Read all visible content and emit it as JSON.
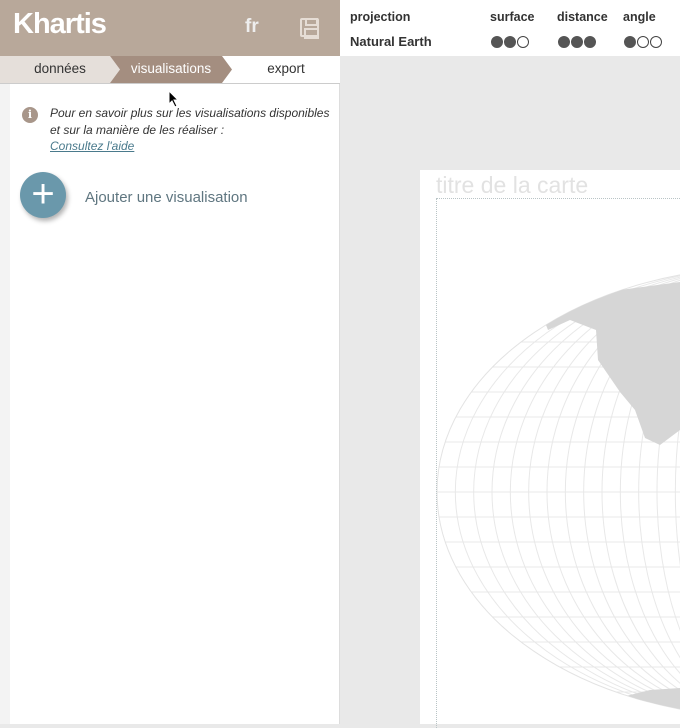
{
  "app": {
    "title": "Khartis",
    "language": "fr",
    "save_icon": "floppy-disk-icon"
  },
  "tabs": [
    {
      "label": "données",
      "state": "done"
    },
    {
      "label": "visualisations",
      "state": "active"
    },
    {
      "label": "export",
      "state": "upcoming"
    }
  ],
  "info": {
    "icon": "info-icon",
    "text": "Pour en savoir plus sur les visualisations disponibles et sur la manière de les réaliser :",
    "link": "Consultez l'aide"
  },
  "add_visualization": {
    "icon": "plus-icon",
    "label": "Ajouter une visualisation"
  },
  "projection_panel": {
    "headers": {
      "projection": "projection",
      "surface": "surface",
      "distance": "distance",
      "angle": "angle"
    },
    "projection": "Natural Earth",
    "ratings": {
      "surface": 2,
      "distance": 3,
      "angle": 1
    },
    "rating_max": 3
  },
  "map": {
    "title_placeholder": "titre de la carte",
    "projection": "Natural Earth",
    "land_color": "#d6d6d6",
    "graticule_color": "#e6e6e6"
  },
  "colors": {
    "header": "#b8a89a",
    "active_tab": "#a48e80",
    "add_button": "#6a98ab"
  }
}
